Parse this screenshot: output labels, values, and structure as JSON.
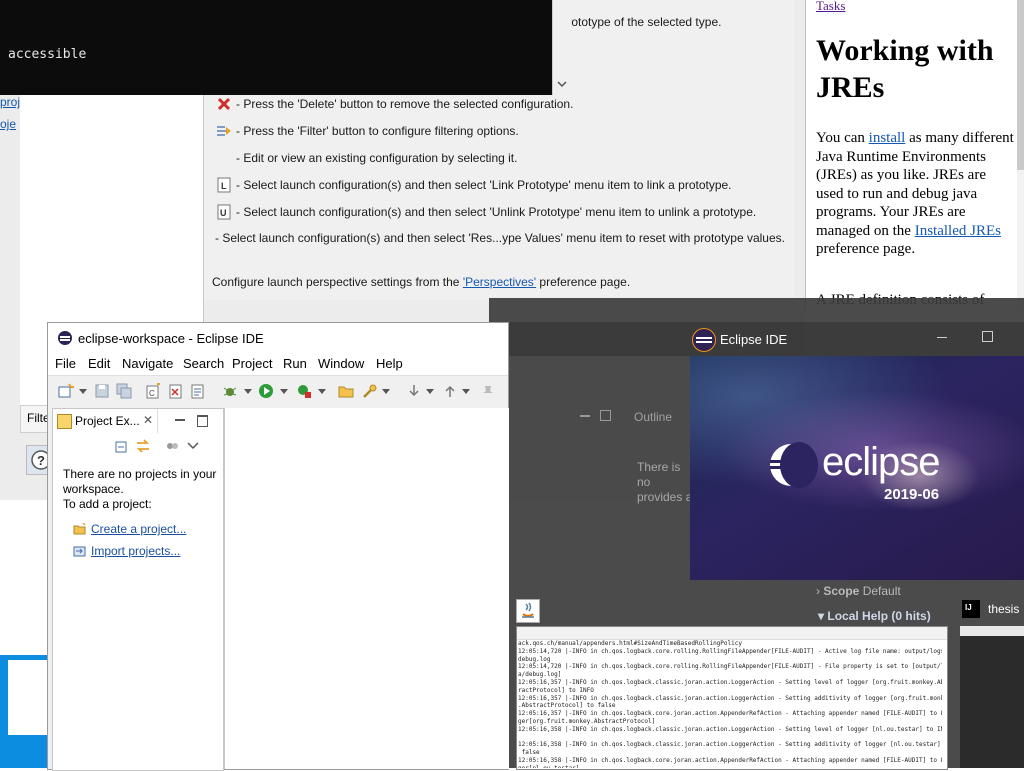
{
  "terminal": {
    "line": "accessible"
  },
  "bg_help": {
    "top_fragment": "tion prototype of the selected type.",
    "rows": [
      "- Press the 'Delete' button to remove the selected configuration.",
      "- Press the 'Filter' button to configure filtering options.",
      "- Edit or view an existing configuration by selecting it.",
      "- Select launch configuration(s) and then select 'Link Prototype' menu item to link a prototype.",
      "- Select launch configuration(s) and then select 'Unlink Prototype' menu item to unlink a prototype.",
      "- Select launch configuration(s) and then select 'Res...ype Values' menu item to reset with prototype values."
    ],
    "perspectives_prefix": "Configure launch perspective settings from the ",
    "perspectives_link": "'Perspectives'",
    "perspectives_suffix": " preference page.",
    "left_links": [
      "proj",
      "oje"
    ],
    "filter_tab": "Filte"
  },
  "browser": {
    "crumb": "Tasks",
    "heading": "Working with JREs",
    "p1_a": "You can ",
    "p1_link1": "install",
    "p1_b": " as many different Java Runtime Environments (JREs) as you like. JREs are used to run and debug java programs. Your JREs are managed on the ",
    "p1_link2": "Installed JREs",
    "p1_c": " preference page.",
    "p2": "A JRE definition consists of"
  },
  "eclipse_workspace": {
    "title": "eclipse-workspace - Eclipse IDE",
    "menu": [
      "File",
      "Edit",
      "Navigate",
      "Search",
      "Project",
      "Run",
      "Window",
      "Help"
    ],
    "project_explorer": {
      "tab": "Project Ex...",
      "close": "✕",
      "message_line1": "There are no projects in your workspace.",
      "message_line2": "To add a project:",
      "links": [
        "Create a project...",
        "Import projects..."
      ]
    }
  },
  "splash": {
    "window_title": "Eclipse IDE",
    "brand": "eclipse",
    "version": "2019-06"
  },
  "ghost": {
    "outline": "Outline",
    "outline_text": "There is no provides a",
    "scope_label": "Scope",
    "scope_value": "Default",
    "local_help": "Local Help (0 hits)"
  },
  "taskbar": {
    "log_lines": "ack.qos.ch/manual/appenders.html#SizeAndTimeBasedRollingPolicy\n12:05:14,720 |-INFO in ch.qos.logback.core.rolling.RollingFileAppender[FILE-AUDIT] - Active log file name: output/logs/audit/\ndebug.log\n12:05:14,720 |-INFO in ch.qos.logback.core.rolling.RollingFileAppender[FILE-AUDIT] - File property is set to [output/logs/\na/debug.log]\n12:05:16,357 |-INFO in ch.qos.logback.classic.joran.action.LoggerAction - Setting level of logger [org.fruit.monkey.Abst\nractProtocol] to INFO\n12:05:16,357 |-INFO in ch.qos.logback.classic.joran.action.LoggerAction - Setting additivity of logger [org.fruit.monkey\n.AbstractProtocol] to false\n12:05:16,357 |-INFO in ch.qos.logback.core.joran.action.AppenderRefAction - Attaching appender named [FILE-AUDIT] to Log\nger[org.fruit.monkey.AbstractProtocol]\n12:05:16,358 |-INFO in ch.qos.logback.classic.joran.action.LoggerAction - Setting level of logger [nl.ou.testar] to INFO\n\n12:05:16,358 |-INFO in ch.qos.logback.classic.joran.action.LoggerAction - Setting additivity of logger [nl.ou.testar] to\n false\n12:05:16,358 |-INFO in ch.qos.logback.core.joran.action.AppenderRefAction - Attaching appender named [FILE-AUDIT] to Log\nger[nl.ou.testar]\n12:05:16,358 |-INFO in ch.qos.logback.classic.joran.action.RootLoggerAction - Setting level of ROOT logger to ERROR",
    "ij_title": "thesis",
    "ij_icon": "IJ"
  }
}
